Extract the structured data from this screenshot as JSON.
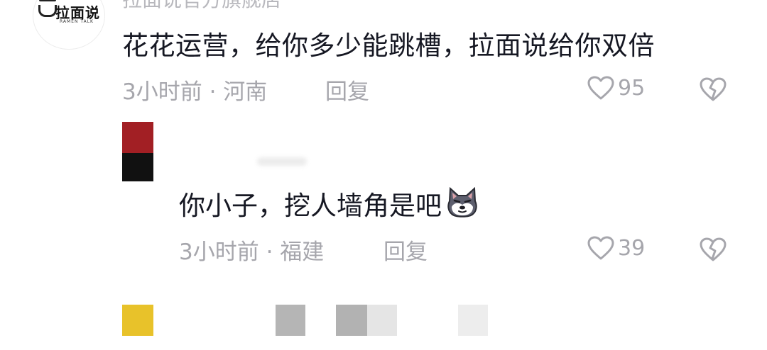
{
  "comments": [
    {
      "nickname": "拉面说官方旗舰店",
      "avatar_logo_text": "拉面说",
      "avatar_logo_sub": "RAMEN TALK",
      "text": "花花运营，给你多少能跳槽，拉面说给你双倍",
      "time": "3小时前",
      "location": "河南",
      "reply_label": "回复",
      "like_count": "95"
    },
    {
      "text": "你小子，挖人墙角是吧",
      "time": "3小时前",
      "location": "福建",
      "reply_label": "回复",
      "like_count": "39"
    }
  ],
  "meta_separator": " · ",
  "icons": {
    "like": "heart-outline-icon",
    "dislike": "broken-heart-icon",
    "emoji": "husky-dog-emoji-icon"
  },
  "colors": {
    "text_primary": "#161823",
    "text_secondary": "#a6a6ac",
    "avatar_red": "#a21f24",
    "placeholder_yellow": "#e8c22a"
  }
}
